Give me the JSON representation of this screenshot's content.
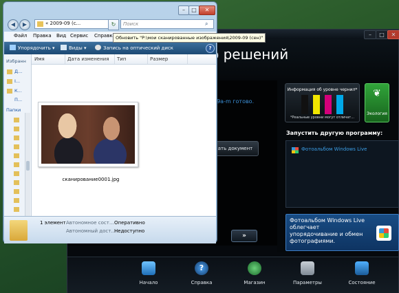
{
  "hp": {
    "title": "о решений",
    "status": "09а-m готово.",
    "scan_document": "ать документ",
    "next": "»",
    "ink_title": "Информация об уровне чернил*",
    "ink_note": "*Реальные уровни могут отличат...",
    "ink_colors": [
      "#111111",
      "#f1e600",
      "#d4007a",
      "#00a8e8"
    ],
    "eco_label": "Экология",
    "eco_icon": "leaf-icon",
    "other_program_label": "Запустить другую программу:",
    "app_item": "Фотоальбом Windows Live",
    "promo_text": "Фотоальбом Windows Live облегчает упорядочивание и обмен фотографиями.",
    "taskbar": [
      {
        "label": "Начало",
        "icon": "home-icon"
      },
      {
        "label": "Справка",
        "icon": "help-icon",
        "glyph": "?"
      },
      {
        "label": "Магазин",
        "icon": "globe-icon"
      },
      {
        "label": "Параметры",
        "icon": "wrench-icon"
      },
      {
        "label": "Состояние",
        "icon": "status-icon"
      }
    ],
    "window_buttons": {
      "min": "–",
      "max": "□",
      "close": "✕"
    }
  },
  "explorer": {
    "window_buttons": {
      "min": "–",
      "max": "□",
      "close": "✕"
    },
    "nav_back": "◀",
    "nav_fwd": "▶",
    "address": "« 2009-09 (с...",
    "address_chevron": "▾",
    "refresh": "↻",
    "search_placeholder": "Поиск",
    "search_icon_glyph": "⌕",
    "menu": [
      "Файл",
      "Правка",
      "Вид",
      "Сервис",
      "Справка"
    ],
    "tooltip": "Обновить \"P:\\мои сканированные изображения\\2009-09 (сен)\"",
    "toolbar": {
      "organize": "Упорядочить ▾",
      "views": "Виды ▾",
      "burn": "Запись на оптический диск"
    },
    "help_glyph": "?",
    "favorites_label": "Избранн",
    "favorites": [
      "Д...",
      "I...",
      "К...",
      "П..."
    ],
    "folders_label": "Папки",
    "columns": [
      "Имя",
      "Дата изменения",
      "Тип",
      "Размер"
    ],
    "file_name": "сканирование0001.jpg",
    "details": {
      "count": "1 элемент",
      "offline_status_label": "Автономное сост...",
      "offline_status_value": "Оперативно",
      "offline_avail_label": "Автономный дост...",
      "offline_avail_value": "Недоступно"
    }
  }
}
